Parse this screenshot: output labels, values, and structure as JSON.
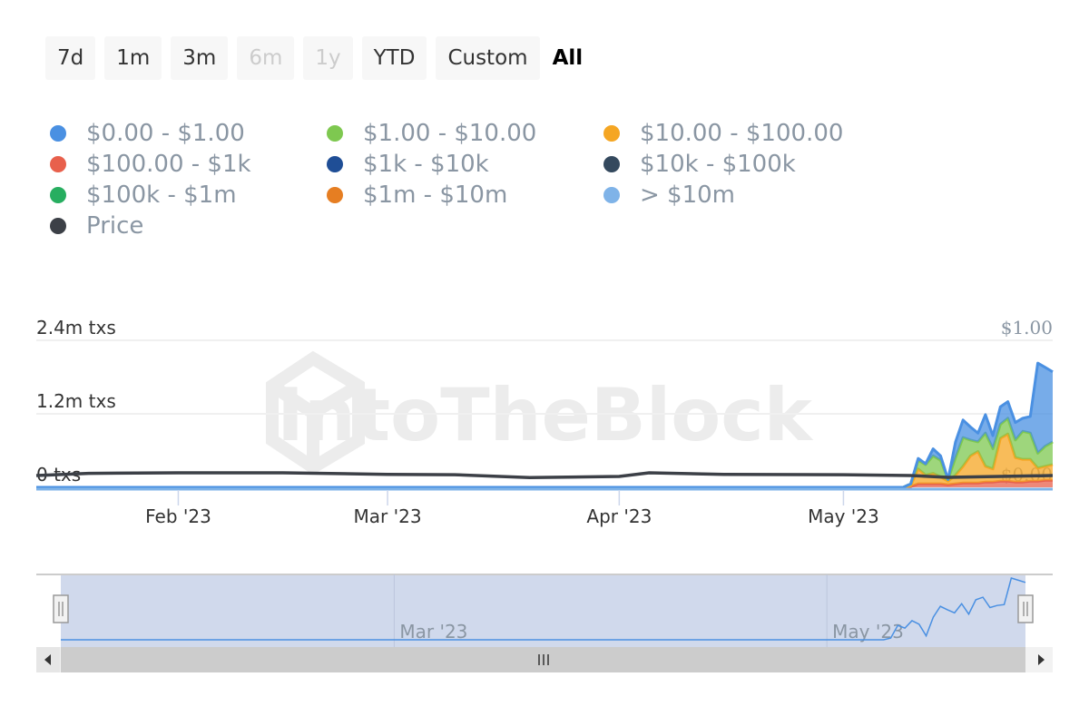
{
  "range_selector": {
    "buttons": [
      {
        "label": "7d",
        "state": "normal"
      },
      {
        "label": "1m",
        "state": "normal"
      },
      {
        "label": "3m",
        "state": "normal"
      },
      {
        "label": "6m",
        "state": "disabled"
      },
      {
        "label": "1y",
        "state": "disabled"
      },
      {
        "label": "YTD",
        "state": "normal"
      },
      {
        "label": "Custom",
        "state": "normal"
      },
      {
        "label": "All",
        "state": "selected"
      }
    ]
  },
  "legend": [
    {
      "label": "$0.00 - $1.00",
      "color": "#4a90e2"
    },
    {
      "label": "$1.00 - $10.00",
      "color": "#7ec850"
    },
    {
      "label": "$10.00 - $100.00",
      "color": "#f5a623"
    },
    {
      "label": "$100.00 - $1k",
      "color": "#e8604c"
    },
    {
      "label": "$1k - $10k",
      "color": "#1f4e96"
    },
    {
      "label": "$10k - $100k",
      "color": "#34495e"
    },
    {
      "label": "$100k - $1m",
      "color": "#27ae60"
    },
    {
      "label": "$1m - $10m",
      "color": "#e67e22"
    },
    {
      "label": "> $10m",
      "color": "#7fb3e8"
    },
    {
      "label": "Price",
      "color": "#3c4047"
    }
  ],
  "watermark": "IntoTheBlock",
  "chart_data": {
    "type": "area",
    "stacked": true,
    "xlim": [
      "2023-01-13",
      "2023-05-29"
    ],
    "x_ticks": [
      {
        "date": "2023-02-01",
        "label": "Feb '23"
      },
      {
        "date": "2023-03-01",
        "label": "Mar '23"
      },
      {
        "date": "2023-04-01",
        "label": "Apr '23"
      },
      {
        "date": "2023-05-01",
        "label": "May '23"
      }
    ],
    "y_left": {
      "ticks": [
        {
          "value": 0,
          "label": "0 txs"
        },
        {
          "value": 1200000,
          "label": "1.2m txs"
        },
        {
          "value": 2400000,
          "label": "2.4m txs"
        }
      ],
      "ylim": [
        0,
        2400000
      ]
    },
    "y_right": {
      "ticks": [
        {
          "value": 0,
          "label": "$0.00"
        },
        {
          "value": 1,
          "label": "$1.00"
        }
      ],
      "ylim": [
        0,
        1
      ]
    },
    "grid": true,
    "x": [
      "2023-01-13",
      "2023-05-09",
      "2023-05-10",
      "2023-05-11",
      "2023-05-12",
      "2023-05-13",
      "2023-05-14",
      "2023-05-15",
      "2023-05-16",
      "2023-05-17",
      "2023-05-18",
      "2023-05-19",
      "2023-05-20",
      "2023-05-21",
      "2023-05-22",
      "2023-05-23",
      "2023-05-24",
      "2023-05-25",
      "2023-05-26",
      "2023-05-27",
      "2023-05-28",
      "2023-05-29"
    ],
    "series": [
      {
        "name": "$0.00 - $1.00",
        "color": "#4a90e2",
        "values": [
          0,
          0,
          0,
          29000,
          14000,
          114000,
          71000,
          0,
          257000,
          286000,
          214000,
          143000,
          300000,
          214000,
          286000,
          271000,
          286000,
          214000,
          271000,
          1471000,
          1286000,
          1143000
        ]
      },
      {
        "name": "$1.00 - $10.00",
        "color": "#7ec850",
        "values": [
          0,
          0,
          29000,
          143000,
          171000,
          286000,
          271000,
          29000,
          286000,
          471000,
          257000,
          157000,
          543000,
          329000,
          229000,
          257000,
          286000,
          457000,
          429000,
          243000,
          329000,
          371000
        ]
      },
      {
        "name": "$10.00 - $100.00",
        "color": "#f5a623",
        "values": [
          0,
          0,
          14000,
          243000,
          143000,
          171000,
          114000,
          57000,
          143000,
          271000,
          443000,
          514000,
          257000,
          214000,
          700000,
          771000,
          400000,
          371000,
          357000,
          214000,
          229000,
          257000
        ]
      },
      {
        "name": "$100.00 - $1k",
        "color": "#e8604c",
        "values": [
          0,
          0,
          14000,
          57000,
          57000,
          57000,
          57000,
          43000,
          57000,
          71000,
          71000,
          71000,
          86000,
          86000,
          100000,
          100000,
          86000,
          86000,
          100000,
          100000,
          114000,
          114000
        ]
      }
    ],
    "price": {
      "name": "Price",
      "color": "#3c4047",
      "axis": "right",
      "x": [
        "2023-01-13",
        "2023-01-20",
        "2023-02-01",
        "2023-02-15",
        "2023-03-01",
        "2023-03-10",
        "2023-03-20",
        "2023-04-01",
        "2023-04-05",
        "2023-04-15",
        "2023-05-01",
        "2023-05-10",
        "2023-05-15",
        "2023-05-29"
      ],
      "values": [
        0.08,
        0.095,
        0.099,
        0.099,
        0.088,
        0.086,
        0.066,
        0.074,
        0.099,
        0.088,
        0.086,
        0.08,
        0.068,
        0.08
      ]
    },
    "navigator": {
      "x_ticks": [
        {
          "date": "2023-03-01",
          "label": "Mar '23"
        },
        {
          "date": "2023-05-01",
          "label": "May '23"
        }
      ]
    }
  }
}
